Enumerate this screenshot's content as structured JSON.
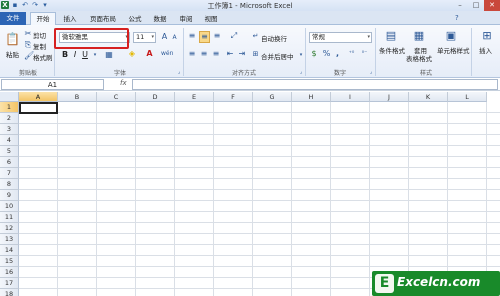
{
  "window": {
    "title": "工作簿1 - Microsoft Excel"
  },
  "qat": {
    "icons": [
      "excel-icon",
      "save-icon",
      "undo-icon",
      "redo-icon",
      "dropdown-icon"
    ]
  },
  "tabs": [
    {
      "label": "文件"
    },
    {
      "label": "开始"
    },
    {
      "label": "插入"
    },
    {
      "label": "页面布局"
    },
    {
      "label": "公式"
    },
    {
      "label": "数据"
    },
    {
      "label": "审阅"
    },
    {
      "label": "视图"
    }
  ],
  "ribbon": {
    "clipboard": {
      "paste": "粘贴",
      "cut": "剪切",
      "copy": "复制",
      "format_painter": "格式刷",
      "group_label": "剪贴板"
    },
    "font": {
      "name": "微软雅黑",
      "size": "11",
      "bold": "B",
      "italic": "I",
      "underline": "U",
      "grow": "A",
      "shrink": "A",
      "color_letter": "A",
      "wen": "wén",
      "group_label": "字体"
    },
    "alignment": {
      "wrap": "自动换行",
      "merge": "合并后居中",
      "group_label": "对齐方式"
    },
    "number": {
      "format": "常规",
      "percent": "%",
      "comma": ",",
      "group_label": "数字"
    },
    "styles": {
      "conditional": "条件格式",
      "table": "套用",
      "table2": "表格格式",
      "cell": "单元格样式",
      "group_label": "样式"
    },
    "cells": {
      "insert": "插入"
    }
  },
  "formula_bar": {
    "cell_ref": "A1",
    "fx": "fx"
  },
  "sheet": {
    "columns": [
      "A",
      "B",
      "C",
      "D",
      "E",
      "F",
      "G",
      "H",
      "I",
      "J",
      "K",
      "L"
    ],
    "rows": [
      "1",
      "2",
      "3",
      "4",
      "5",
      "6",
      "7",
      "8",
      "9",
      "10",
      "11",
      "12",
      "13",
      "14",
      "15",
      "16",
      "17",
      "18"
    ]
  },
  "watermark": {
    "badge": "E",
    "text": "Excelcn.com"
  },
  "colors": {
    "file_tab": "#2c64b5",
    "highlight": "#d62020",
    "watermark_bg": "#198a2a",
    "selected_header": "#f3c466"
  }
}
